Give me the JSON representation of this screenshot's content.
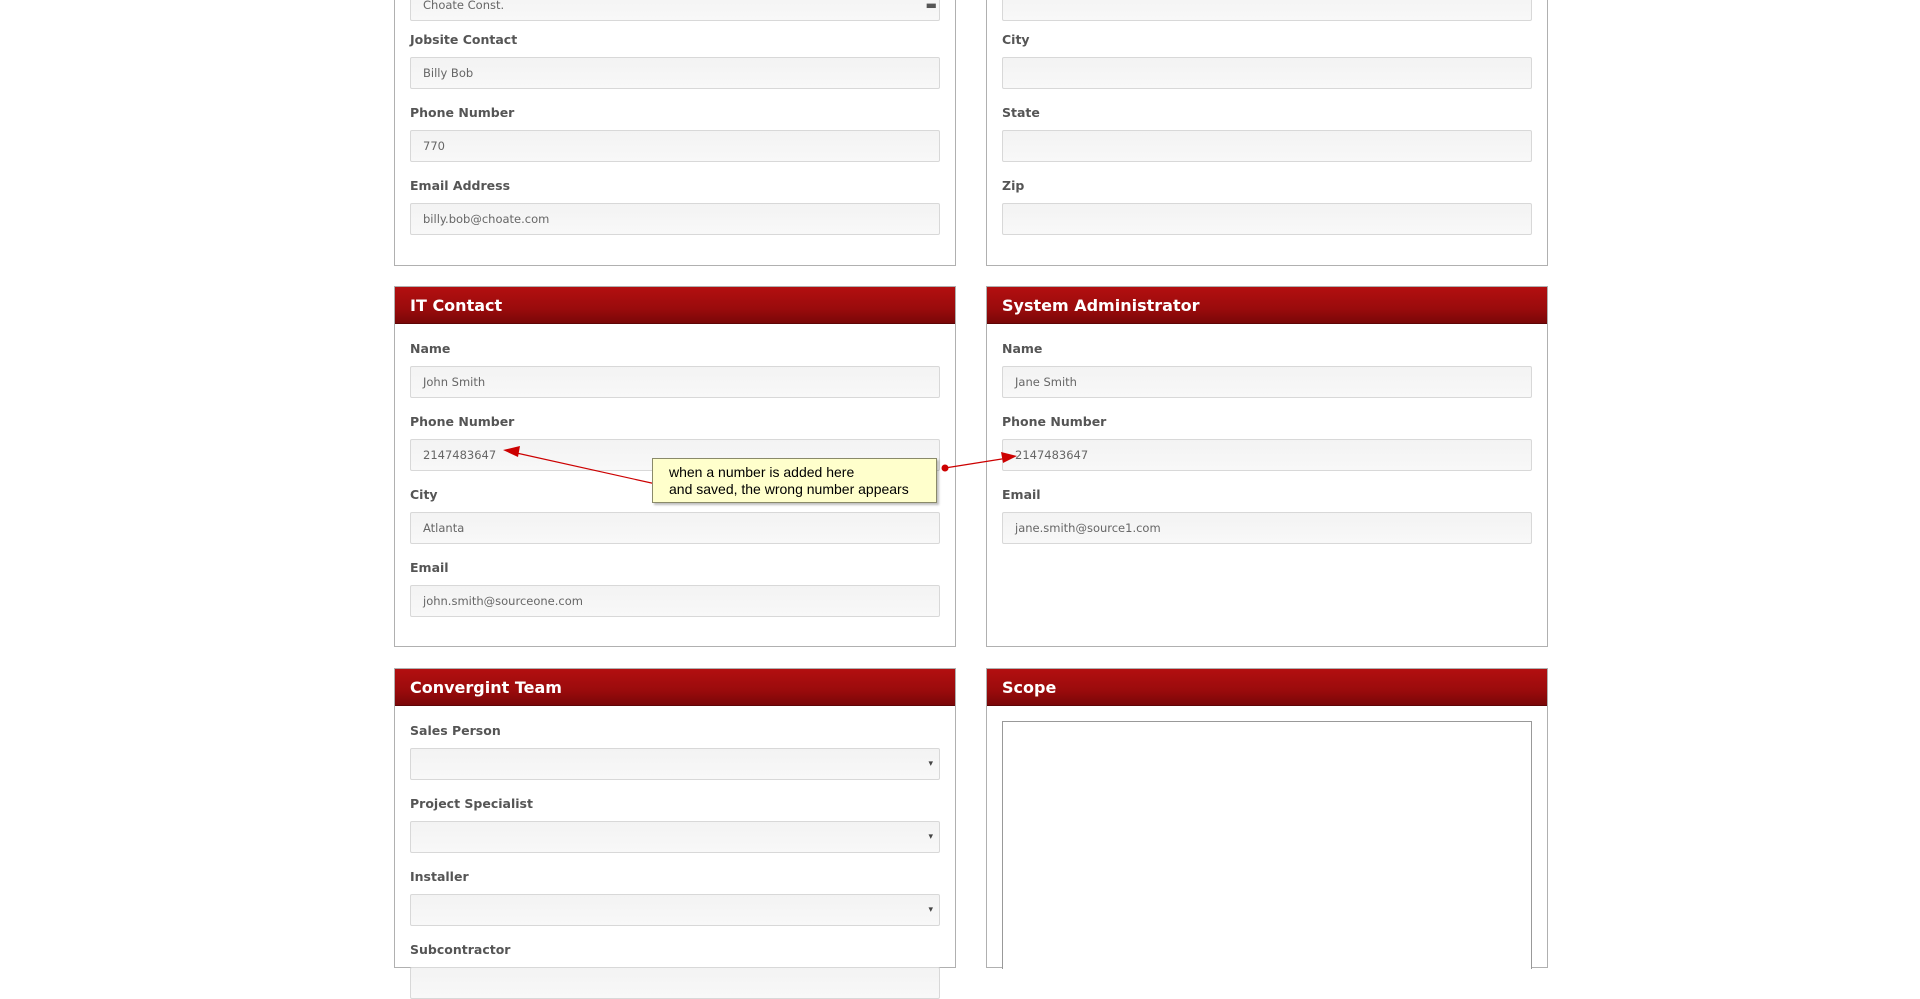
{
  "top_left": {
    "partial_field_value": "Choate Const.",
    "fields": [
      {
        "label": "Jobsite Contact",
        "value": "Billy Bob"
      },
      {
        "label": "Phone Number",
        "value": "770"
      },
      {
        "label": "Email Address",
        "value": "billy.bob@choate.com"
      }
    ]
  },
  "top_right": {
    "fields": [
      {
        "label": "City",
        "value": ""
      },
      {
        "label": "State",
        "value": ""
      },
      {
        "label": "Zip",
        "value": ""
      }
    ]
  },
  "it_contact": {
    "title": "IT Contact",
    "fields": [
      {
        "label": "Name",
        "value": "John Smith"
      },
      {
        "label": "Phone Number",
        "value": "2147483647"
      },
      {
        "label": "City",
        "value": "Atlanta"
      },
      {
        "label": "Email",
        "value": "john.smith@sourceone.com"
      }
    ]
  },
  "sys_admin": {
    "title": "System Administrator",
    "fields": [
      {
        "label": "Name",
        "value": "Jane Smith"
      },
      {
        "label": "Phone Number",
        "value": "2147483647"
      },
      {
        "label": "Email",
        "value": "jane.smith@source1.com"
      }
    ]
  },
  "team": {
    "title": "Convergint Team",
    "fields": [
      {
        "label": "Sales Person",
        "value": ""
      },
      {
        "label": "Project Specialist",
        "value": ""
      },
      {
        "label": "Installer",
        "value": ""
      },
      {
        "label": "Subcontractor",
        "value": ""
      }
    ],
    "caret": "▾"
  },
  "scope": {
    "title": "Scope"
  },
  "annotation": {
    "line1": "when a number is added here",
    "line2": "and saved, the wrong number appears",
    "color": "#cc0000"
  },
  "colors": {
    "header": "#9a0b0c",
    "callout_bg": "#ffffcc"
  }
}
